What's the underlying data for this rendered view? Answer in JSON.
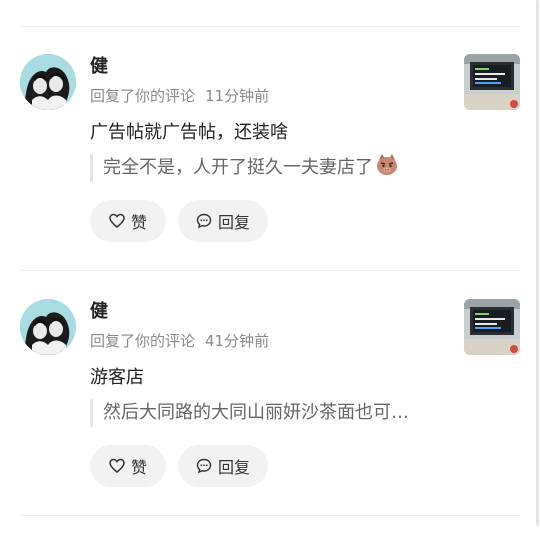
{
  "notifications": [
    {
      "user_name": "健",
      "action": "回复了你的评论",
      "time": "11分钟前",
      "comment": "广告帖就广告帖，还装啥",
      "quoted": "完全不是，人开了挺久一夫妻店了",
      "quoted_emoji": "angry-pig-emoji",
      "like_label": "赞",
      "reply_label": "回复",
      "avatar_icon": "couple-photo-avatar",
      "thumbnail_icon": "bus-display-thumbnail"
    },
    {
      "user_name": "健",
      "action": "回复了你的评论",
      "time": "41分钟前",
      "comment": "游客店",
      "quoted": "然后大同路的大同山丽妍沙茶面也可…",
      "like_label": "赞",
      "reply_label": "回复",
      "avatar_icon": "couple-photo-avatar",
      "thumbnail_icon": "bus-display-thumbnail"
    }
  ],
  "colors": {
    "avatar_bg": "#a9dce2",
    "button_bg": "#f2f2f2",
    "meta_text": "#8a8a8a",
    "quote_bar": "#e6e6e6"
  }
}
